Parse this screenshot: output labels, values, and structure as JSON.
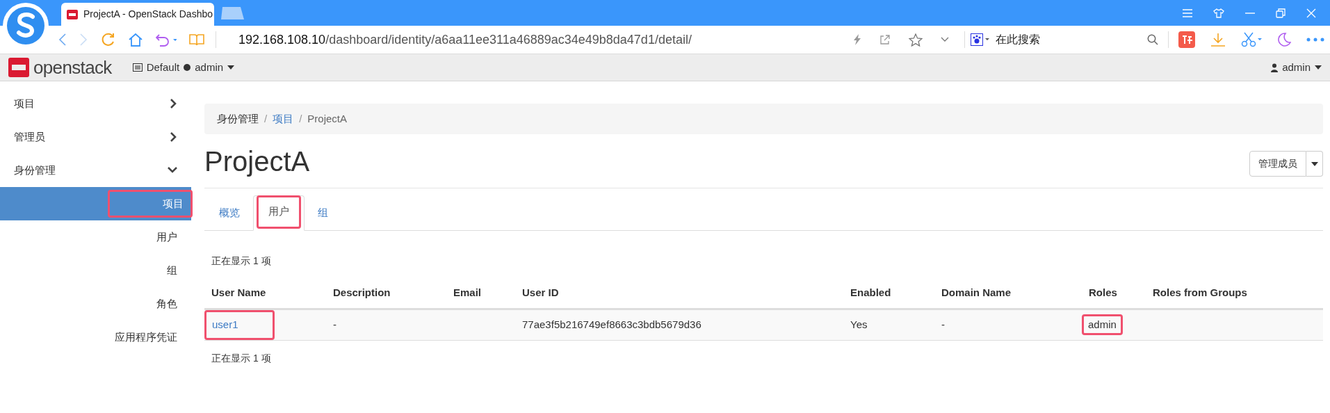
{
  "browser": {
    "tab_title": "ProjectA - OpenStack Dashbo",
    "address_host": "192.168.108.10",
    "address_path": "/dashboard/identity/a6aa11ee311a46889ac34e49b8da47d1/detail/",
    "search_placeholder": "在此搜索"
  },
  "header": {
    "logo_text": "openstack",
    "domain": "Default",
    "project": "admin",
    "user": "admin"
  },
  "sidebar": {
    "items": [
      {
        "label": "项目",
        "expanded": false
      },
      {
        "label": "管理员",
        "expanded": false
      },
      {
        "label": "身份管理",
        "expanded": true,
        "children": [
          {
            "label": "项目",
            "selected": true,
            "highlighted": true
          },
          {
            "label": "用户",
            "selected": false,
            "highlighted": false
          },
          {
            "label": "组",
            "selected": false,
            "highlighted": false
          },
          {
            "label": "角色",
            "selected": false,
            "highlighted": false
          },
          {
            "label": "应用程序凭证",
            "selected": false,
            "highlighted": false
          }
        ]
      }
    ]
  },
  "breadcrumb": {
    "separator": "/",
    "items": [
      {
        "label": "身份管理",
        "kind": "text"
      },
      {
        "label": "项目",
        "kind": "link"
      },
      {
        "label": "ProjectA",
        "kind": "current"
      }
    ]
  },
  "page_title": "ProjectA",
  "action_button": {
    "label": "管理成员"
  },
  "tabs": [
    {
      "label": "概览",
      "selected": false,
      "highlighted": false
    },
    {
      "label": "用户",
      "selected": true,
      "highlighted": true
    },
    {
      "label": "组",
      "selected": false,
      "highlighted": false
    }
  ],
  "table": {
    "summary": "正在显示 1 项",
    "columns": [
      "User Name",
      "Description",
      "Email",
      "User ID",
      "Enabled",
      "Domain Name",
      "Roles",
      "Roles from Groups"
    ],
    "rows": [
      {
        "cells": [
          {
            "text": "user1",
            "kind": "link",
            "highlighted": true
          },
          {
            "text": "-",
            "kind": "text",
            "highlighted": false
          },
          null,
          {
            "text": "77ae3f5b216749ef8663c3bdb5679d36",
            "kind": "text",
            "highlighted": false
          },
          {
            "text": "Yes",
            "kind": "text",
            "highlighted": false
          },
          {
            "text": "-",
            "kind": "text",
            "highlighted": false
          },
          {
            "text": "admin",
            "kind": "text",
            "highlighted": true
          },
          null
        ]
      }
    ],
    "footer": "正在显示 1 项"
  }
}
